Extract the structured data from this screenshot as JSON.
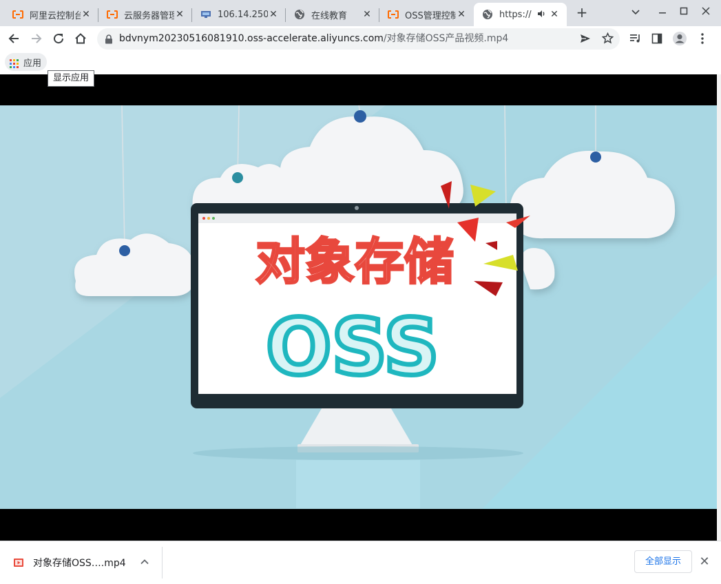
{
  "tabs": [
    {
      "title": "阿里云控制台",
      "icon": "aliyun-icon"
    },
    {
      "title": "云服务器管理",
      "icon": "aliyun-icon"
    },
    {
      "title": "106.14.250",
      "icon": "remote-desktop-icon"
    },
    {
      "title": "在线教育",
      "icon": "globe-icon"
    },
    {
      "title": "OSS管理控制",
      "icon": "aliyun-icon"
    },
    {
      "title": "https://",
      "icon": "globe-icon",
      "active": true,
      "audio": true
    }
  ],
  "address_bar": {
    "host": "bdvnym20230516081910.oss-accelerate.aliyuncs.com",
    "path": "/对象存储OSS产品视频.mp4"
  },
  "bookmarks": {
    "apps_label": "应用",
    "tooltip": "显示应用"
  },
  "video": {
    "title_cn": "对象存储",
    "title_en": "OSS"
  },
  "download": {
    "filename": "对象存储OSS….mp4",
    "show_all_label": "全部显示"
  },
  "colors": {
    "tabstrip_bg": "#dee1e6",
    "aliyun_orange": "#ff6a00",
    "link_blue": "#1a73e8",
    "sky": "#a9dbe8",
    "title_red": "#e8483d",
    "oss_teal": "#1fb7bf"
  }
}
